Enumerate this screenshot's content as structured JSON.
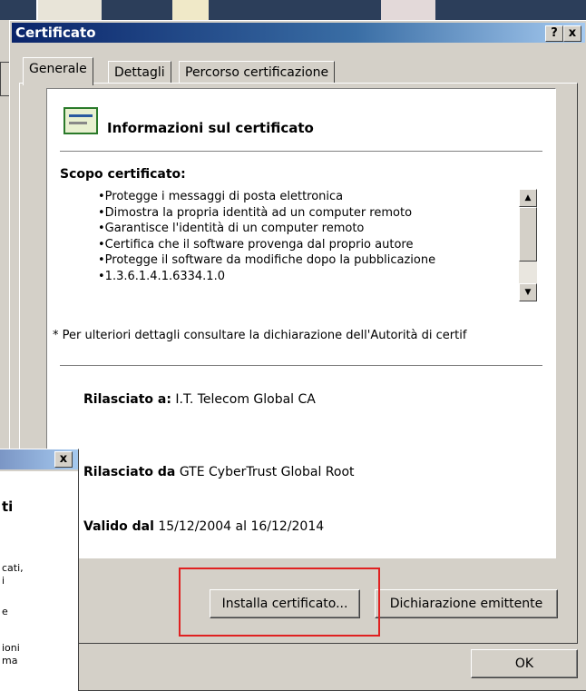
{
  "window": {
    "title": "Certificato",
    "help_label": "?",
    "close_label": "x"
  },
  "tabs": [
    {
      "label": "Generale",
      "active": true
    },
    {
      "label": "Dettagli",
      "active": false
    },
    {
      "label": "Percorso certificazione",
      "active": false
    }
  ],
  "info": {
    "icon": "certificate-icon",
    "heading": "Informazioni sul certificato",
    "scope_label": "Scopo certificato:",
    "purposes": [
      "Protegge i messaggi di posta elettronica",
      "Dimostra la propria identità ad un computer remoto",
      "Garantisce l'identità di un computer remoto",
      "Certifica che il software provenga dal proprio autore",
      "Protegge il software da modifiche dopo la pubblicazione",
      "1.3.6.1.4.1.6334.1.0"
    ],
    "note": "* Per ulteriori dettagli consultare la dichiarazione dell'Autorità di certif",
    "issued_to_label": "Rilasciato a:",
    "issued_to_value": "I.T. Telecom Global CA",
    "issued_by_label": "Rilasciato da",
    "issued_by_value": "GTE CyberTrust Global Root",
    "valid_label": "Valido dal",
    "valid_from": "15/12/2004",
    "valid_sep": "al",
    "valid_to": "16/12/2014"
  },
  "buttons": {
    "install": "Installa certificato...",
    "declaration": "Dichiarazione emittente",
    "ok": "OK"
  },
  "mini_dialog": {
    "close_label": "x",
    "fragments": [
      "ti",
      "cati,",
      "i",
      "e",
      "ioni",
      "ma"
    ]
  },
  "colors": {
    "highlight": "#e02020",
    "title_bar": "#0a246a"
  }
}
